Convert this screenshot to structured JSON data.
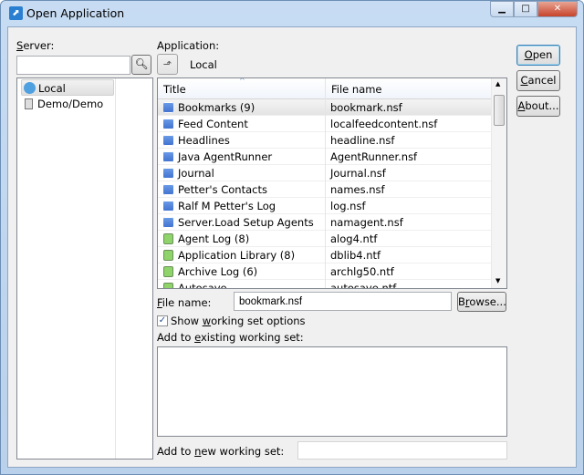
{
  "window": {
    "title": "Open Application"
  },
  "server": {
    "label": "Server:",
    "label_accel": "S",
    "label_rest": "erver:",
    "input_value": "",
    "tree": [
      {
        "label": "Local",
        "icon": "local-server-icon",
        "selected": true
      },
      {
        "label": "Demo/Demo",
        "icon": "server-icon",
        "selected": false
      }
    ]
  },
  "application": {
    "label": "Application:",
    "location": "Local"
  },
  "table": {
    "columns": [
      "Title",
      "File name"
    ],
    "sort_column": "Title",
    "rows": [
      {
        "title": "Bookmarks (9)",
        "file": "bookmark.nsf",
        "icon": "database-icon",
        "selected": true
      },
      {
        "title": "Feed Content",
        "file": "localfeedcontent.nsf",
        "icon": "database-icon"
      },
      {
        "title": "Headlines",
        "file": "headline.nsf",
        "icon": "database-icon"
      },
      {
        "title": "Java AgentRunner",
        "file": "AgentRunner.nsf",
        "icon": "database-icon"
      },
      {
        "title": "Journal",
        "file": "Journal.nsf",
        "icon": "database-icon"
      },
      {
        "title": "Petter's Contacts",
        "file": "names.nsf",
        "icon": "database-icon"
      },
      {
        "title": "Ralf M Petter's Log",
        "file": "log.nsf",
        "icon": "database-icon"
      },
      {
        "title": "Server.Load Setup Agents",
        "file": "namagent.nsf",
        "icon": "database-icon"
      },
      {
        "title": "Agent Log (8)",
        "file": "alog4.ntf",
        "icon": "template-icon"
      },
      {
        "title": "Application Library (8)",
        "file": "dblib4.ntf",
        "icon": "template-icon"
      },
      {
        "title": "Archive Log (6)",
        "file": "archlg50.ntf",
        "icon": "template-icon"
      },
      {
        "title": "Autosave",
        "file": "autosave.ntf",
        "icon": "template-icon"
      }
    ]
  },
  "file_name": {
    "accel": "F",
    "rest": "ile name:",
    "value": "bookmark.nsf"
  },
  "browse": {
    "pre": "B",
    "accel": "r",
    "post": "owse..."
  },
  "working_set": {
    "checkbox_pre": "Show ",
    "checkbox_accel": "w",
    "checkbox_post": "orking set options",
    "checked": true,
    "existing_pre": "Add to ",
    "existing_accel": "e",
    "existing_post": "xisting working set:",
    "new_pre": "Add to ",
    "new_accel": "n",
    "new_post": "ew working set:",
    "new_value": ""
  },
  "buttons": {
    "open_accel": "O",
    "open_rest": "pen",
    "cancel_accel": "C",
    "cancel_rest": "ancel",
    "about_accel": "A",
    "about_rest": "bout..."
  }
}
